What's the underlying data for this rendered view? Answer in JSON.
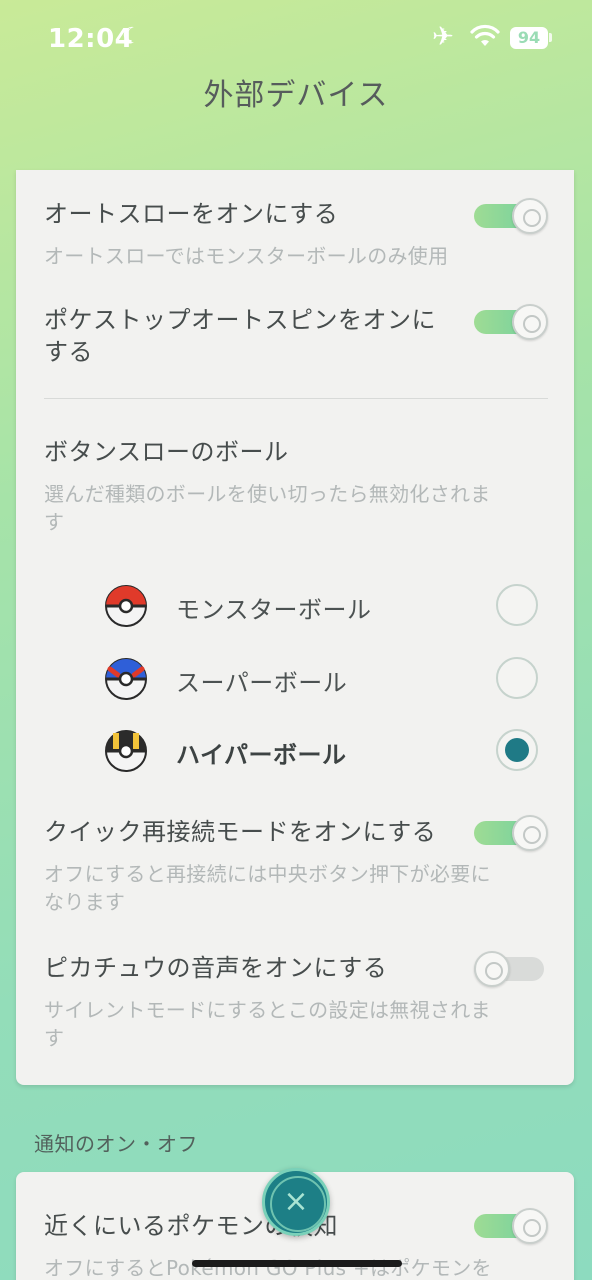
{
  "status_bar": {
    "time": "12:04",
    "battery": "94"
  },
  "title": "外部デバイス",
  "settings": {
    "auto_throw": {
      "title": "オートスローをオンにする",
      "desc": "オートスローではモンスターボールのみ使用",
      "enabled": true
    },
    "auto_spin": {
      "title_line1": "ポケストップオートスピンをオンに",
      "title_line2": "する",
      "enabled": true
    },
    "ball_select": {
      "title": "ボタンスローのボール",
      "desc_line1": "選んだ種類のボールを使い切ったら無効化されま",
      "desc_line2": "す",
      "balls": [
        {
          "label": "モンスターボール",
          "selected": false
        },
        {
          "label": "スーパーボール",
          "selected": false
        },
        {
          "label": "ハイパーボール",
          "selected": true
        }
      ]
    },
    "quick_reconnect": {
      "title": "クイック再接続モードをオンにする",
      "desc_line1": "オフにすると再接続には中央ボタン押下が必要に",
      "desc_line2": "なります",
      "enabled": true
    },
    "pikachu_voice": {
      "title": "ピカチュウの音声をオンにする",
      "desc_line1": "サイレントモードにするとこの設定は無視されま",
      "desc_line2": "す",
      "enabled": false
    }
  },
  "notifications": {
    "section_label": "通知のオン・オフ",
    "nearby": {
      "title": "近くにいるポケモンの検知",
      "desc": "オフにするとPokémon GO Plus +はポケモンを",
      "enabled": true
    }
  },
  "icons": {
    "moon": "moon-icon",
    "airplane": "airplane-icon",
    "wifi": "wifi-icon",
    "close": "close-icon"
  },
  "colors": {
    "accent": "#1f7a86",
    "toggle_on": "#6fcfa0"
  }
}
